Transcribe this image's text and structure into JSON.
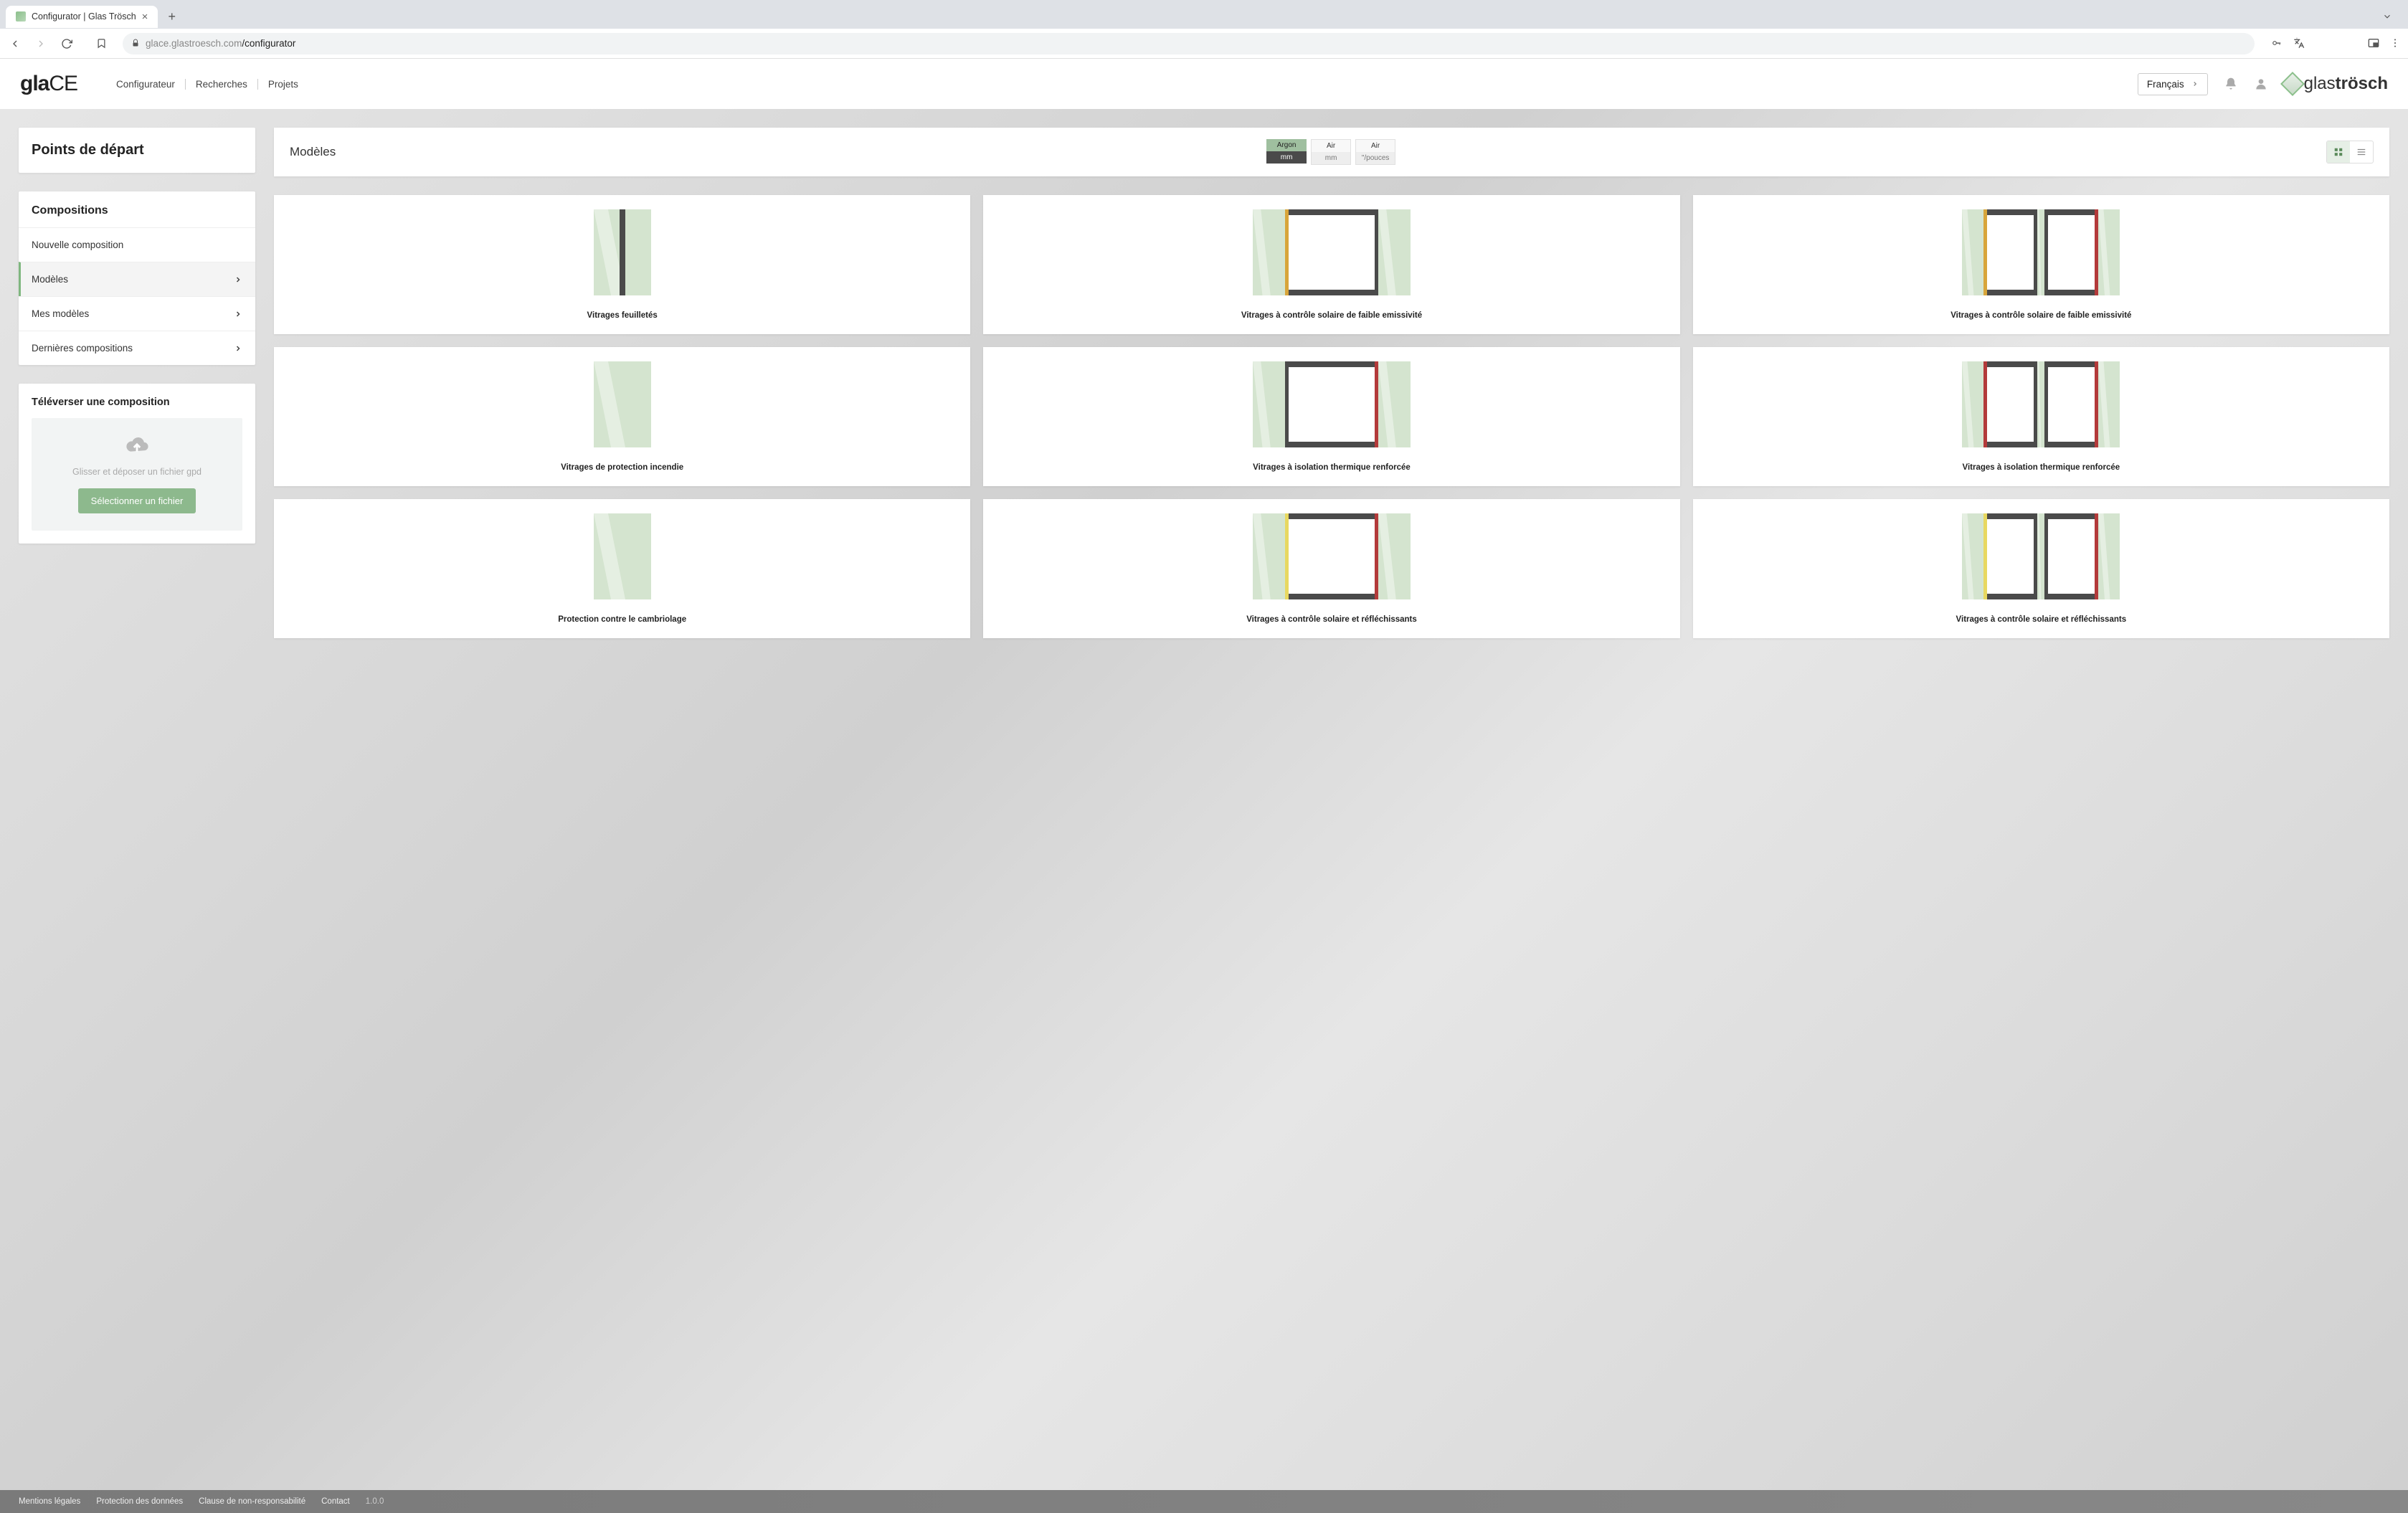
{
  "browser": {
    "tab_title": "Configurator | Glas Trösch",
    "url_host": "glace.glastroesch.com",
    "url_path": "/configurator"
  },
  "header": {
    "logo_bold": "gla",
    "logo_light": "CE",
    "nav": [
      "Configurateur",
      "Recherches",
      "Projets"
    ],
    "language": "Français",
    "brand_light": "glas",
    "brand_bold": "trösch"
  },
  "sidebar": {
    "title": "Points de départ",
    "section_title": "Compositions",
    "items": [
      {
        "label": "Nouvelle composition",
        "chevron": false,
        "active": false
      },
      {
        "label": "Modèles",
        "chevron": true,
        "active": true
      },
      {
        "label": "Mes modèles",
        "chevron": true,
        "active": false
      },
      {
        "label": "Dernières compositions",
        "chevron": true,
        "active": false
      }
    ],
    "upload_title": "Téléverser une composition",
    "upload_hint": "Glisser et déposer un fichier gpd",
    "upload_button": "Sélectionner un fichier"
  },
  "main": {
    "title": "Modèles",
    "toggles": [
      {
        "top": "Argon",
        "bottom": "mm",
        "active": true
      },
      {
        "top": "Air",
        "bottom": "mm",
        "active": false
      },
      {
        "top": "Air",
        "bottom": "\"/pouces",
        "active": false
      }
    ],
    "cards": [
      {
        "label": "Vitrages feuilletés",
        "kind": "single"
      },
      {
        "label": "Vitrages à contrôle solaire de faible emissivité",
        "kind": "double",
        "left": "#d8a53a",
        "right": "#4a4a4a"
      },
      {
        "label": "Vitrages à contrôle solaire de faible emissivité",
        "kind": "triple",
        "left": "#d8a53a",
        "mid": "#4a4a4a",
        "right": "#b33a3a"
      },
      {
        "label": "Vitrages de protection incendie",
        "kind": "plain"
      },
      {
        "label": "Vitrages à isolation thermique renforcée",
        "kind": "double",
        "left": "#4a4a4a",
        "right": "#b33a3a"
      },
      {
        "label": "Vitrages à isolation thermique renforcée",
        "kind": "triple",
        "left": "#b33a3a",
        "mid": "#4a4a4a",
        "right": "#b33a3a"
      },
      {
        "label": "Protection contre le cambriolage",
        "kind": "plain"
      },
      {
        "label": "Vitrages à contrôle solaire et réfléchissants",
        "kind": "double",
        "left": "#e8d860",
        "right": "#b33a3a"
      },
      {
        "label": "Vitrages à contrôle solaire et réfléchissants",
        "kind": "triple",
        "left": "#e8d860",
        "mid": "#4a4a4a",
        "right": "#b33a3a"
      }
    ]
  },
  "footer": {
    "links": [
      "Mentions légales",
      "Protection des données",
      "Clause de non-responsabilité",
      "Contact"
    ],
    "version": "1.0.0"
  },
  "colors": {
    "accent": "#8db98d",
    "glass": "#d4e4cf",
    "frame": "#4a4a4a"
  }
}
